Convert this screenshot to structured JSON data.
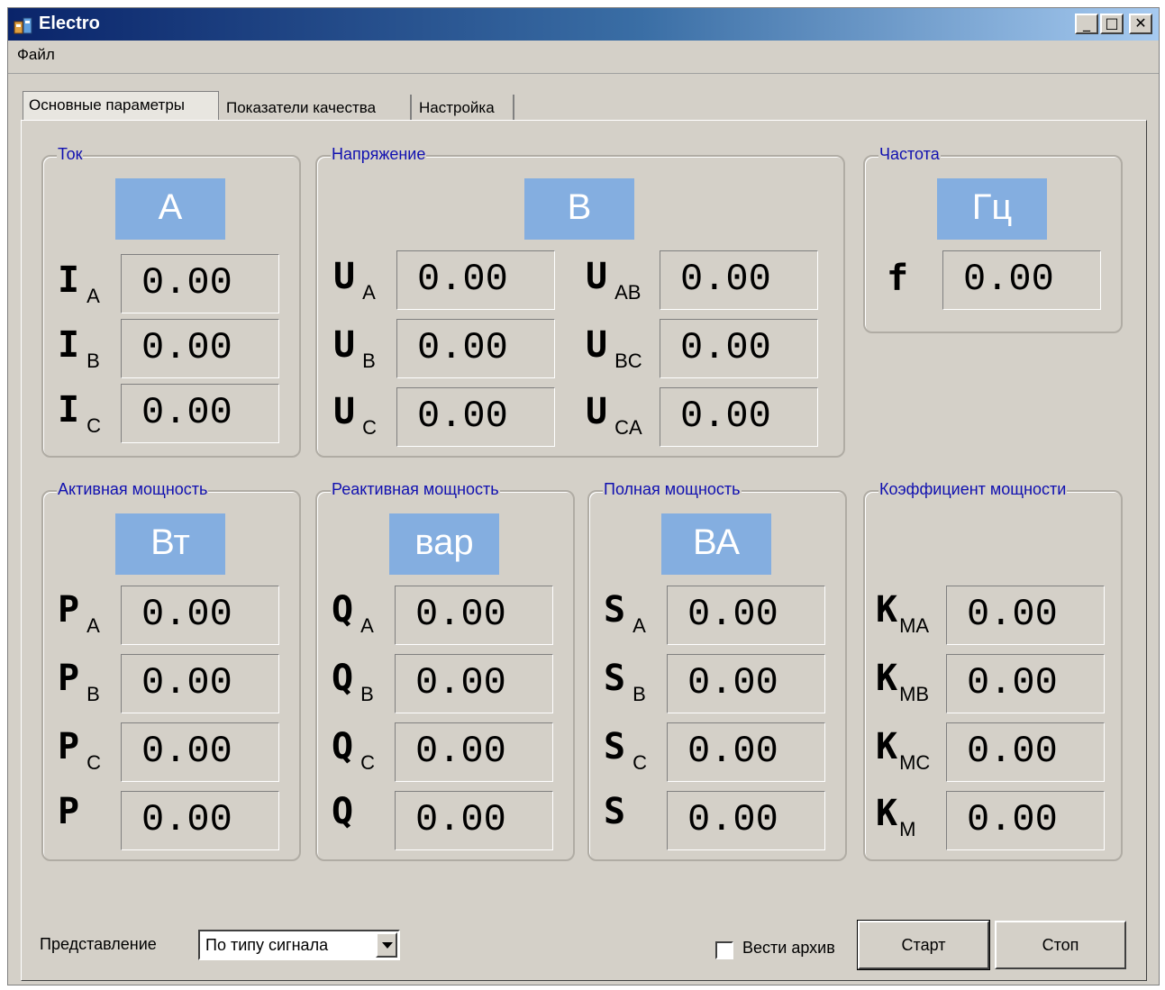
{
  "window": {
    "title": "Electro",
    "min_icon": "minimize-icon",
    "max_icon": "maximize-icon",
    "close_icon": "close-icon"
  },
  "menu": {
    "file": "Файл"
  },
  "tabs": [
    "Основные параметры",
    "Показатели качества",
    "Настройка"
  ],
  "groups": {
    "current": {
      "title": "Ток",
      "unit": "А",
      "rows": [
        {
          "sym": "I",
          "sub": "A",
          "value": "0.00"
        },
        {
          "sym": "I",
          "sub": "B",
          "value": "0.00"
        },
        {
          "sym": "I",
          "sub": "C",
          "value": "0.00"
        }
      ]
    },
    "voltage": {
      "title": "Напряжение",
      "unit": "В",
      "rows": [
        {
          "sym": "U",
          "sub": "A",
          "value": "0.00"
        },
        {
          "sym": "U",
          "sub": "B",
          "value": "0.00"
        },
        {
          "sym": "U",
          "sub": "C",
          "value": "0.00"
        }
      ],
      "rows2": [
        {
          "sym": "U",
          "sub": "AB",
          "value": "0.00"
        },
        {
          "sym": "U",
          "sub": "BC",
          "value": "0.00"
        },
        {
          "sym": "U",
          "sub": "CA",
          "value": "0.00"
        }
      ]
    },
    "frequency": {
      "title": "Частота",
      "unit": "Гц",
      "rows": [
        {
          "sym": "f",
          "sub": "",
          "value": "0.00"
        }
      ]
    },
    "active": {
      "title": "Активная мощность",
      "unit": "Вт",
      "rows": [
        {
          "sym": "P",
          "sub": "A",
          "value": "0.00"
        },
        {
          "sym": "P",
          "sub": "B",
          "value": "0.00"
        },
        {
          "sym": "P",
          "sub": "C",
          "value": "0.00"
        },
        {
          "sym": "P",
          "sub": "",
          "value": "0.00"
        }
      ]
    },
    "reactive": {
      "title": "Реактивная мощность",
      "unit": "вар",
      "rows": [
        {
          "sym": "Q",
          "sub": "A",
          "value": "0.00"
        },
        {
          "sym": "Q",
          "sub": "B",
          "value": "0.00"
        },
        {
          "sym": "Q",
          "sub": "C",
          "value": "0.00"
        },
        {
          "sym": "Q",
          "sub": "",
          "value": "0.00"
        }
      ]
    },
    "full": {
      "title": "Полная мощность",
      "unit": "ВА",
      "rows": [
        {
          "sym": "S",
          "sub": "A",
          "value": "0.00"
        },
        {
          "sym": "S",
          "sub": "B",
          "value": "0.00"
        },
        {
          "sym": "S",
          "sub": "C",
          "value": "0.00"
        },
        {
          "sym": "S",
          "sub": "",
          "value": "0.00"
        }
      ]
    },
    "pf": {
      "title": "Коэффициент мощности",
      "rows": [
        {
          "sym": "K",
          "sub": "MA",
          "value": "0.00"
        },
        {
          "sym": "K",
          "sub": "MB",
          "value": "0.00"
        },
        {
          "sym": "K",
          "sub": "MC",
          "value": "0.00"
        },
        {
          "sym": "K",
          "sub": "M",
          "value": "0.00"
        }
      ]
    }
  },
  "bottom": {
    "view_label": "Представление",
    "view_value": "По типу сигнала",
    "archive_label": "Вести архив",
    "archive_checked": false,
    "start": "Старт",
    "stop": "Стоп"
  },
  "colors": {
    "unit_bg": "#84aee0",
    "group_title": "#1010b0",
    "title_bar": "#0a246a"
  }
}
